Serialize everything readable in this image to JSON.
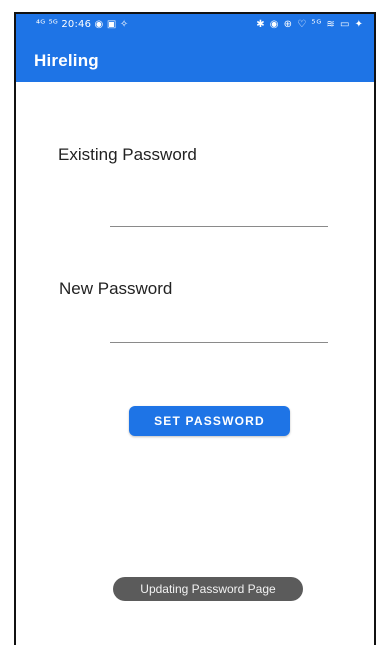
{
  "status_bar": {
    "left_text": "⁴ᴳ ⁵ᴳ 20:46 ◉ ▣ ✧",
    "time": "20:46",
    "right_text": "✱ ◉ ⊕ ♡ ⁵ᴳ ≋ ▭ ✦"
  },
  "app_bar": {
    "title": "Hireling",
    "color": "#1e74e6"
  },
  "form": {
    "existing_password": {
      "label": "Existing Password",
      "value": "",
      "placeholder": ""
    },
    "new_password": {
      "label": "New Password",
      "value": "",
      "placeholder": ""
    },
    "submit_label": "SET PASSWORD"
  },
  "toast": {
    "message": "Updating Password Page"
  }
}
